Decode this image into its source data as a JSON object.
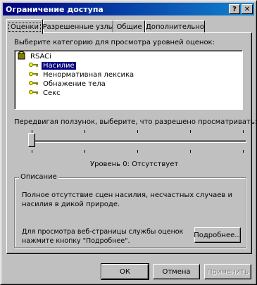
{
  "window": {
    "title": "Ограничение доступа",
    "help_label": "?",
    "close_label": "✕"
  },
  "tabs": [
    {
      "label": "Оценки",
      "active": true
    },
    {
      "label": "Разрешенные узлы",
      "active": false
    },
    {
      "label": "Общие",
      "active": false
    },
    {
      "label": "Дополнительно",
      "active": false
    }
  ],
  "ratings": {
    "category_prompt": "Выберите категорию для просмотра уровней оценок:",
    "tree": {
      "root": "RSACi",
      "items": [
        {
          "label": "Насилие",
          "selected": true
        },
        {
          "label": "Ненормативная лексика",
          "selected": false
        },
        {
          "label": "Обнажение тела",
          "selected": false
        },
        {
          "label": "Секс",
          "selected": false
        }
      ]
    },
    "slider_prompt": "Передвигая ползунок, выберите, что разрешено просматривать:",
    "slider": {
      "level_text": "Уровень 0:   Отсутствует",
      "level_index": 0,
      "tick_count": 5
    },
    "description": {
      "legend": "Описание",
      "text": "Полное отсутствие сцен насилия, несчастных случаев и насилия в дикой природе.",
      "more_info_text": "Для просмотра веб-страницы службы оценок нажмите кнопку \"Подробнее\".",
      "more_button": "Подробнее..."
    }
  },
  "buttons": {
    "ok": "ОК",
    "cancel": "Отмена",
    "apply": "Применить"
  }
}
